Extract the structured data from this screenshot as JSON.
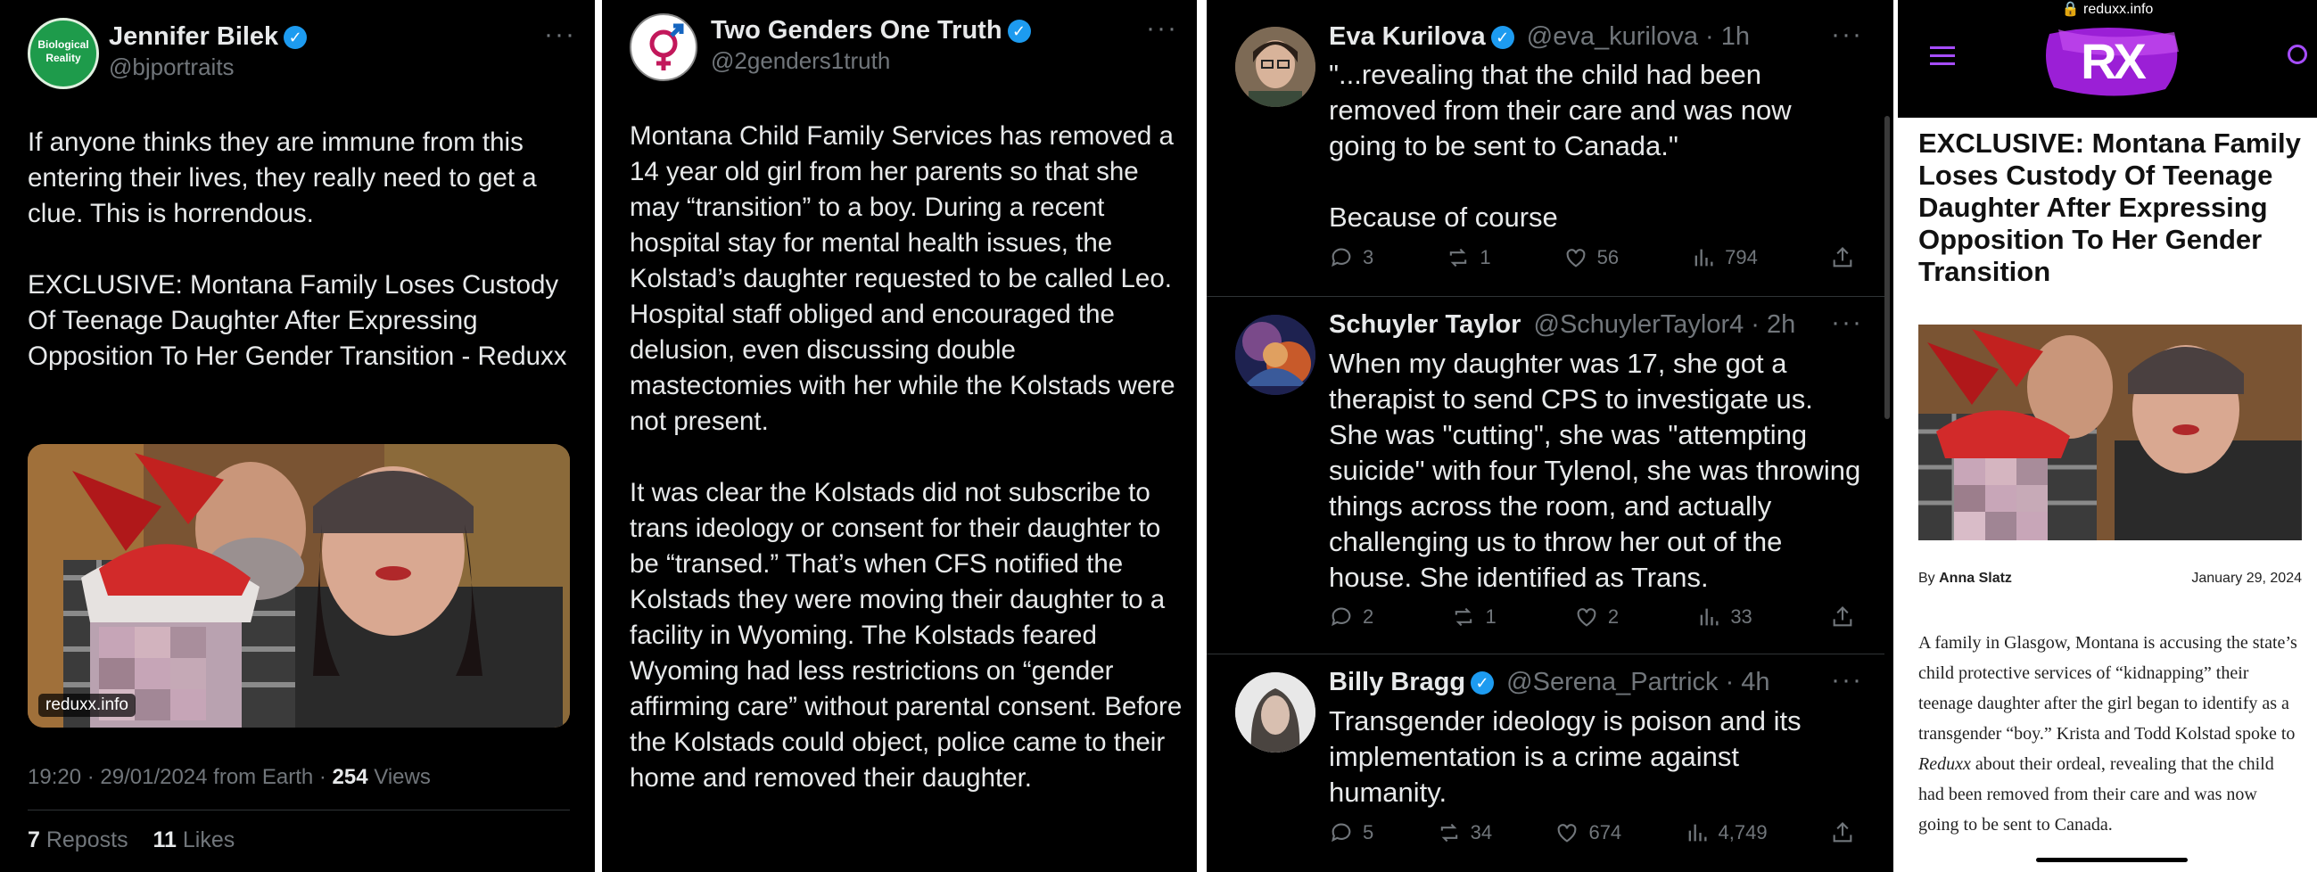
{
  "panel1": {
    "name": "Jennifer Bilek",
    "handle": "@bjportraits",
    "avatar_text": [
      "Biological",
      "Reality"
    ],
    "menu": "···",
    "body": "If anyone thinks they are immune from this entering their lives, they really need to get a clue. This is horrendous.\n\nEXCLUSIVE: Montana Family Loses Custody Of Teenage Daughter After Expressing Opposition To Her Gender Transition - Reduxx",
    "card_source": "reduxx.info",
    "meta_time": "19:20 · 29/01/2024 from Earth · ",
    "meta_views_count": "254",
    "meta_views_label": " Views",
    "reposts_count": "7",
    "reposts_label": " Reposts",
    "likes_count": "11",
    "likes_label": " Likes"
  },
  "panel2": {
    "name": "Two Genders One Truth",
    "handle": "@2genders1truth",
    "menu": "···",
    "body": "Montana Child Family Services has removed a 14 year old girl from her parents so that she may “transition” to a boy. During a recent hospital stay for mental health issues, the Kolstad’s daughter requested to be called Leo. Hospital staff obliged and encouraged the delusion, even discussing double mastectomies with her while the Kolstads were not present.\n\nIt was clear the Kolstads did not subscribe to trans ideology or consent for their daughter to be “transed.” That’s when CFS notified the Kolstads they were moving their daughter to a facility in Wyoming. The Kolstads feared Wyoming had less restrictions on “gender affirming care” without parental consent. Before the Kolstads could object, police came to their home and removed their daughter."
  },
  "panel3": {
    "tweets": [
      {
        "name": "Eva Kurilova",
        "handle": "@eva_kurilova · 1h",
        "body": "\"...revealing that the child had been removed from their care and was now going to be sent to Canada.\"\n\nBecause of course",
        "replies": "3",
        "reposts": "1",
        "likes": "56",
        "views": "794"
      },
      {
        "name": "Schuyler Taylor",
        "handle": "@SchuylerTaylor4 · 2h",
        "body": "When my daughter was 17, she got a therapist to send CPS to investigate us. She was \"cutting\", she was \"attempting suicide\" with four Tylenol, she was throwing things across the room, and actually challenging us to throw her out of the house. She identified as Trans.",
        "replies": "2",
        "reposts": "1",
        "likes": "2",
        "views": "33"
      },
      {
        "name": "Billy Bragg",
        "handle": "@Serena_Partrick · 4h",
        "body": "Transgender ideology is poison and its implementation is a crime against humanity.",
        "replies": "5",
        "reposts": "34",
        "likes": "674",
        "views": "4,749"
      }
    ],
    "menu": "···"
  },
  "panel4": {
    "url": "reduxx.info",
    "logo": "RX",
    "headline": "EXCLUSIVE: Montana Family Loses Custody Of Teenage Daughter After Expressing Opposition To Her Gender Transition",
    "by_prefix": "By ",
    "author": "Anna Slatz",
    "date": "January 29, 2024",
    "article_1": "A family in Glasgow, Montana is accusing the state’s child protective services of “kidnapping” their teenage daughter after the girl began to identify as a transgender “boy.” Krista and Todd Kolstad spoke to ",
    "article_em": "Reduxx",
    "article_2": " about their ordeal, revealing that the child had been removed from their care and was now going to be sent to Canada."
  },
  "colors": {
    "background": "#000000",
    "text": "#e7e9ea",
    "muted": "#71767b",
    "verified": "#1d9bf0",
    "brand_purple": "#8a2be2"
  }
}
